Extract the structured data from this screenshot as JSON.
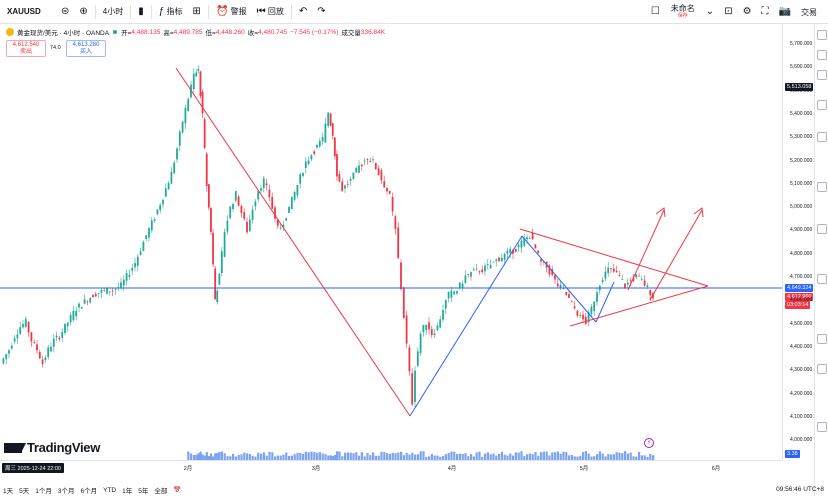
{
  "toolbar": {
    "symbol": "XAUUSD",
    "interval": "4小时",
    "indicators_label": "指标",
    "alert_label": "警报",
    "replay_label": "回放",
    "layout_name": "未命名",
    "layout_status": "保存",
    "trade_label": "交易"
  },
  "legend": {
    "title": "黄金现货/美元 · 4小时 · OANDA",
    "open_key": "开=",
    "open_val": "4,488.135",
    "high_key": "高=",
    "high_val": "4,489.785",
    "low_key": "低=",
    "low_val": "4,448.260",
    "close_key": "收=",
    "close_val": "4,480.745",
    "change": "−7.545 (−0.17%)",
    "volume_key": "成交量",
    "volume_val": "336.84K",
    "sell_price": "4,612.540",
    "sell_label": "卖出",
    "spread": "74.0",
    "buy_price": "4,613.280",
    "buy_label": "买入"
  },
  "price_axis": {
    "ticks": [
      "5,700.000",
      "5,600.000",
      "5,500.000",
      "5,400.000",
      "5,300.000",
      "5,200.000",
      "5,100.000",
      "5,000.000",
      "4,900.000",
      "4,800.000",
      "4,700.000",
      "4,600.000",
      "4,500.000",
      "4,400.000",
      "4,300.000",
      "4,200.000",
      "4,100.000",
      "4,000.000"
    ],
    "tag_crosshair": "5,513.058",
    "tag_line": "4,649.324",
    "tag_last": "4,612.960",
    "tag_countdown": "03:03:14",
    "tag_volume": "3.38"
  },
  "time_axis": {
    "date_tag": "周三 2025-12-24  22:00",
    "labels": [
      "2月",
      "3月",
      "4月",
      "5月",
      "6月"
    ]
  },
  "ranges": [
    "1天",
    "5天",
    "1个月",
    "3个月",
    "6个月",
    "YTD",
    "1年",
    "5年",
    "全部"
  ],
  "clock": "09:56:46 UTC+8",
  "brand": "TradingView",
  "colors": {
    "up": "#22ab94",
    "down": "#f23645",
    "line_blue": "#2962ff",
    "triangle_red": "#f23645",
    "volume": "#5b8def"
  },
  "chart_data": {
    "type": "candlestick",
    "instrument": "XAUUSD",
    "timeframe": "4小时",
    "ylim": [
      3950,
      5760
    ],
    "x_labels": [
      "2月",
      "3月",
      "4月",
      "5月",
      "6月"
    ],
    "path": [
      [
        0,
        4320
      ],
      [
        6,
        4380
      ],
      [
        10,
        4440
      ],
      [
        14,
        4480
      ],
      [
        18,
        4500
      ],
      [
        22,
        4420
      ],
      [
        26,
        4380
      ],
      [
        30,
        4320
      ],
      [
        34,
        4380
      ],
      [
        38,
        4420
      ],
      [
        42,
        4440
      ],
      [
        46,
        4480
      ],
      [
        50,
        4520
      ],
      [
        54,
        4560
      ],
      [
        58,
        4580
      ],
      [
        62,
        4600
      ],
      [
        66,
        4620
      ],
      [
        70,
        4630
      ],
      [
        76,
        4640
      ],
      [
        80,
        4640
      ],
      [
        86,
        4660
      ],
      [
        90,
        4700
      ],
      [
        96,
        4760
      ],
      [
        100,
        4820
      ],
      [
        104,
        4880
      ],
      [
        110,
        4960
      ],
      [
        116,
        5050
      ],
      [
        122,
        5150
      ],
      [
        126,
        5260
      ],
      [
        130,
        5380
      ],
      [
        134,
        5480
      ],
      [
        138,
        5580
      ],
      [
        141,
        5600
      ],
      [
        144,
        5400
      ],
      [
        147,
        5100
      ],
      [
        150,
        4900
      ],
      [
        153,
        4600
      ],
      [
        156,
        4700
      ],
      [
        160,
        4900
      ],
      [
        164,
        5000
      ],
      [
        168,
        5060
      ],
      [
        172,
        4980
      ],
      [
        176,
        4900
      ],
      [
        180,
        5000
      ],
      [
        184,
        5080
      ],
      [
        188,
        5120
      ],
      [
        192,
        5050
      ],
      [
        196,
        4950
      ],
      [
        200,
        4900
      ],
      [
        206,
        5000
      ],
      [
        212,
        5100
      ],
      [
        218,
        5200
      ],
      [
        224,
        5250
      ],
      [
        230,
        5300
      ],
      [
        234,
        5420
      ],
      [
        237,
        5320
      ],
      [
        240,
        5150
      ],
      [
        244,
        5080
      ],
      [
        250,
        5120
      ],
      [
        256,
        5180
      ],
      [
        262,
        5220
      ],
      [
        266,
        5200
      ],
      [
        270,
        5150
      ],
      [
        274,
        5100
      ],
      [
        278,
        5050
      ],
      [
        282,
        4900
      ],
      [
        286,
        4650
      ],
      [
        290,
        4400
      ],
      [
        294,
        4150
      ],
      [
        296,
        4300
      ],
      [
        300,
        4450
      ],
      [
        304,
        4500
      ],
      [
        308,
        4450
      ],
      [
        312,
        4480
      ],
      [
        316,
        4560
      ],
      [
        320,
        4620
      ],
      [
        326,
        4640
      ],
      [
        332,
        4700
      ],
      [
        338,
        4720
      ],
      [
        344,
        4730
      ],
      [
        350,
        4750
      ],
      [
        356,
        4780
      ],
      [
        362,
        4800
      ],
      [
        368,
        4820
      ],
      [
        374,
        4860
      ],
      [
        378,
        4880
      ],
      [
        382,
        4820
      ],
      [
        386,
        4760
      ],
      [
        390,
        4740
      ],
      [
        394,
        4700
      ],
      [
        398,
        4660
      ],
      [
        402,
        4640
      ],
      [
        406,
        4600
      ],
      [
        410,
        4560
      ],
      [
        414,
        4520
      ],
      [
        418,
        4500
      ],
      [
        422,
        4560
      ],
      [
        426,
        4640
      ],
      [
        430,
        4700
      ],
      [
        434,
        4730
      ],
      [
        438,
        4720
      ],
      [
        442,
        4700
      ],
      [
        446,
        4660
      ],
      [
        450,
        4680
      ],
      [
        454,
        4700
      ],
      [
        458,
        4680
      ],
      [
        462,
        4650
      ],
      [
        466,
        4613
      ]
    ]
  }
}
